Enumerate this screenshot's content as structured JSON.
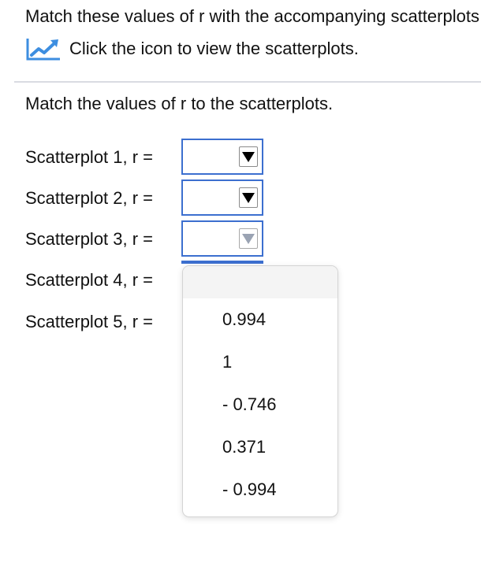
{
  "question": {
    "title": "Match these values of r with the accompanying scatterplots:",
    "icon_link_text": "Click the icon to view the scatterplots.",
    "instructions": "Match the values of r to the scatterplots."
  },
  "rows": [
    {
      "label": "Scatterplot 1, r =",
      "selected": ""
    },
    {
      "label": "Scatterplot 2, r =",
      "selected": ""
    },
    {
      "label": "Scatterplot 3, r =",
      "selected": ""
    },
    {
      "label": "Scatterplot 4, r =",
      "selected": ""
    },
    {
      "label": "Scatterplot 5, r =",
      "selected": ""
    }
  ],
  "dropdown": {
    "open_for_row": 4,
    "options": [
      "",
      "0.994",
      "1",
      "- 0.746",
      "0.371",
      "- 0.994"
    ]
  },
  "icons": {
    "chart_icon": "trend-chart-icon",
    "dropdown_arrow": "triangle-down-icon"
  },
  "colors": {
    "accent": "#3c6fcf",
    "chart_icon_blue": "#3d8ee0",
    "divider": "#d9dbe2",
    "disabled_arrow": "#9aa3b3"
  }
}
